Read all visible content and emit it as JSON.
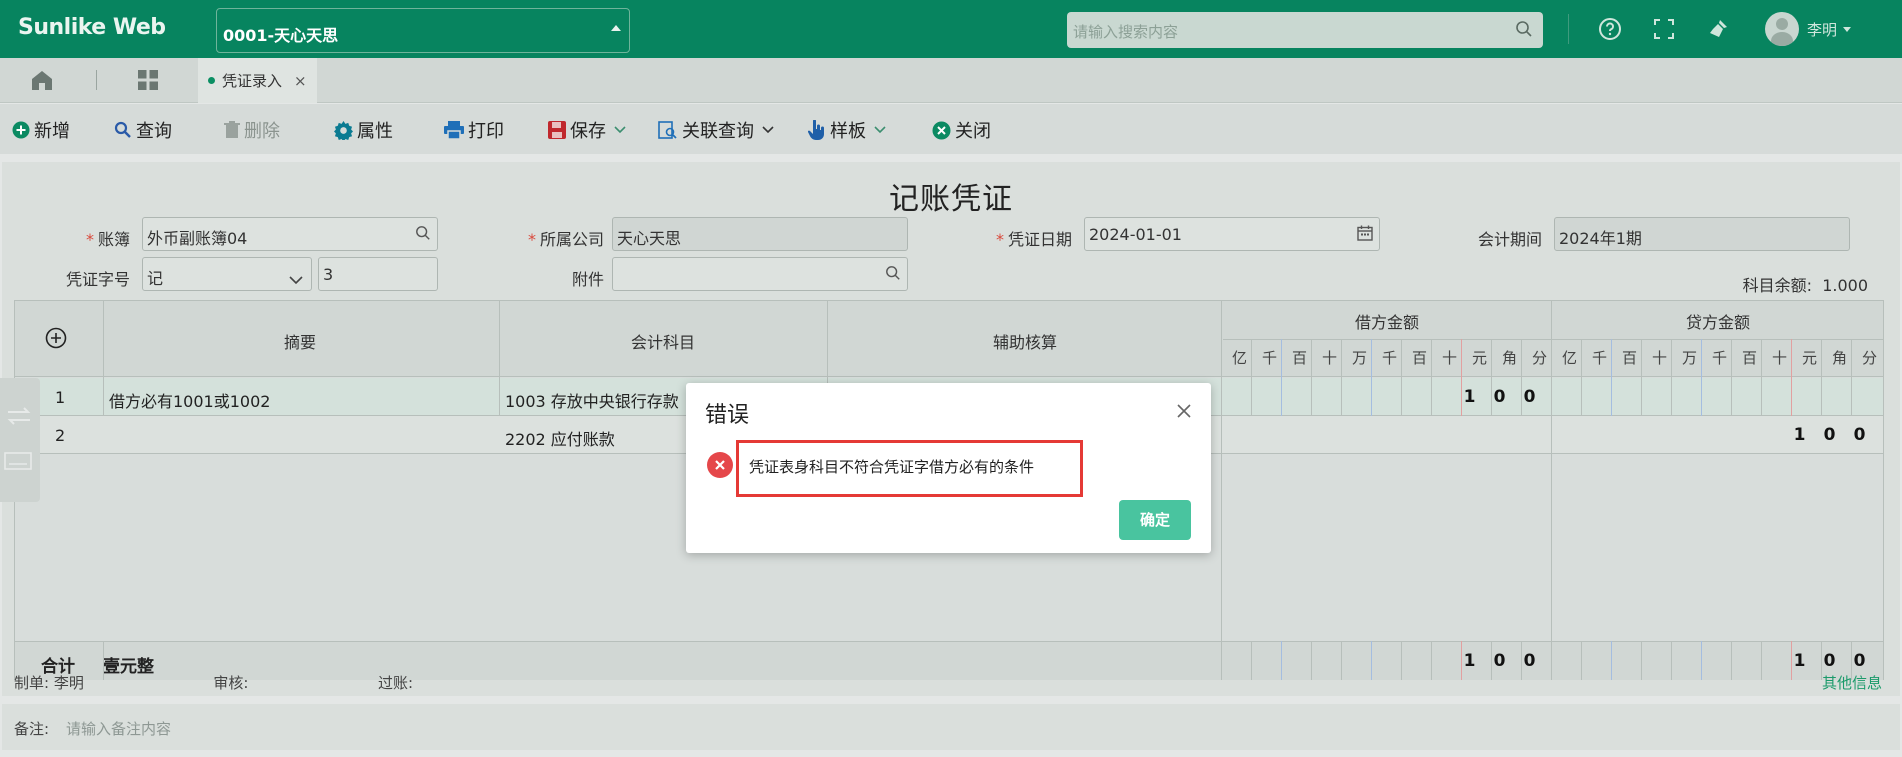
{
  "app": {
    "logo": "Sunlike Web"
  },
  "header": {
    "company": "0001-天心天思",
    "search_placeholder": "请输入搜索内容",
    "user_name": "李明"
  },
  "tabs": {
    "open_tab": "凭证录入",
    "close": "×"
  },
  "toolbar": {
    "add": "新增",
    "query": "查询",
    "delete": "删除",
    "properties": "属性",
    "print": "打印",
    "save": "保存",
    "related_query": "关联查询",
    "template": "样板",
    "close": "关闭"
  },
  "form": {
    "title": "记账凭证",
    "ledger_label": "账簿",
    "ledger_value": "外币副账簿04",
    "company_label": "所属公司",
    "company_value": "天心天思",
    "date_label": "凭证日期",
    "date_value": "2024-01-01",
    "period_label": "会计期间",
    "period_value": "2024年1期",
    "word_label": "凭证字号",
    "word_value": "记",
    "number_value": "3",
    "attachment_label": "附件",
    "attachment_value": "",
    "balance_label": "科目余额:",
    "balance_value": "1.000"
  },
  "grid": {
    "headers": {
      "summary": "摘要",
      "account": "会计科目",
      "auxiliary": "辅助核算",
      "debit": "借方金额",
      "credit": "贷方金额"
    },
    "digits": [
      "亿",
      "千",
      "百",
      "十",
      "万",
      "千",
      "百",
      "十",
      "元",
      "角",
      "分"
    ],
    "rows": [
      {
        "no": "1",
        "summary": "借方必有1001或1002",
        "account": "1003 存放中央银行存款",
        "debit": [
          "1",
          "0",
          "0"
        ],
        "credit": [
          "",
          "",
          ""
        ]
      },
      {
        "no": "2",
        "summary": "",
        "account": "2202 应付账款",
        "debit": [
          "",
          "",
          ""
        ],
        "credit": [
          "1",
          "0",
          "0"
        ]
      }
    ],
    "total_label": "合计",
    "total_text": "壹元整",
    "total_debit": [
      "1",
      "0",
      "0"
    ],
    "total_credit": [
      "1",
      "0",
      "0"
    ]
  },
  "footer": {
    "maker_label": "制单:",
    "maker": "李明",
    "reviewer_label": "审核:",
    "poster_label": "过账:",
    "other_info": "其他信息",
    "remark_label": "备注:",
    "remark_placeholder": "请输入备注内容"
  },
  "dialog": {
    "title": "错误",
    "message": "凭证表身科目不符合凭证字借方必有的条件",
    "ok": "确定"
  },
  "colors": {
    "header_bg": "#07845f",
    "accent": "#49c49f",
    "error": "#e5474a"
  }
}
